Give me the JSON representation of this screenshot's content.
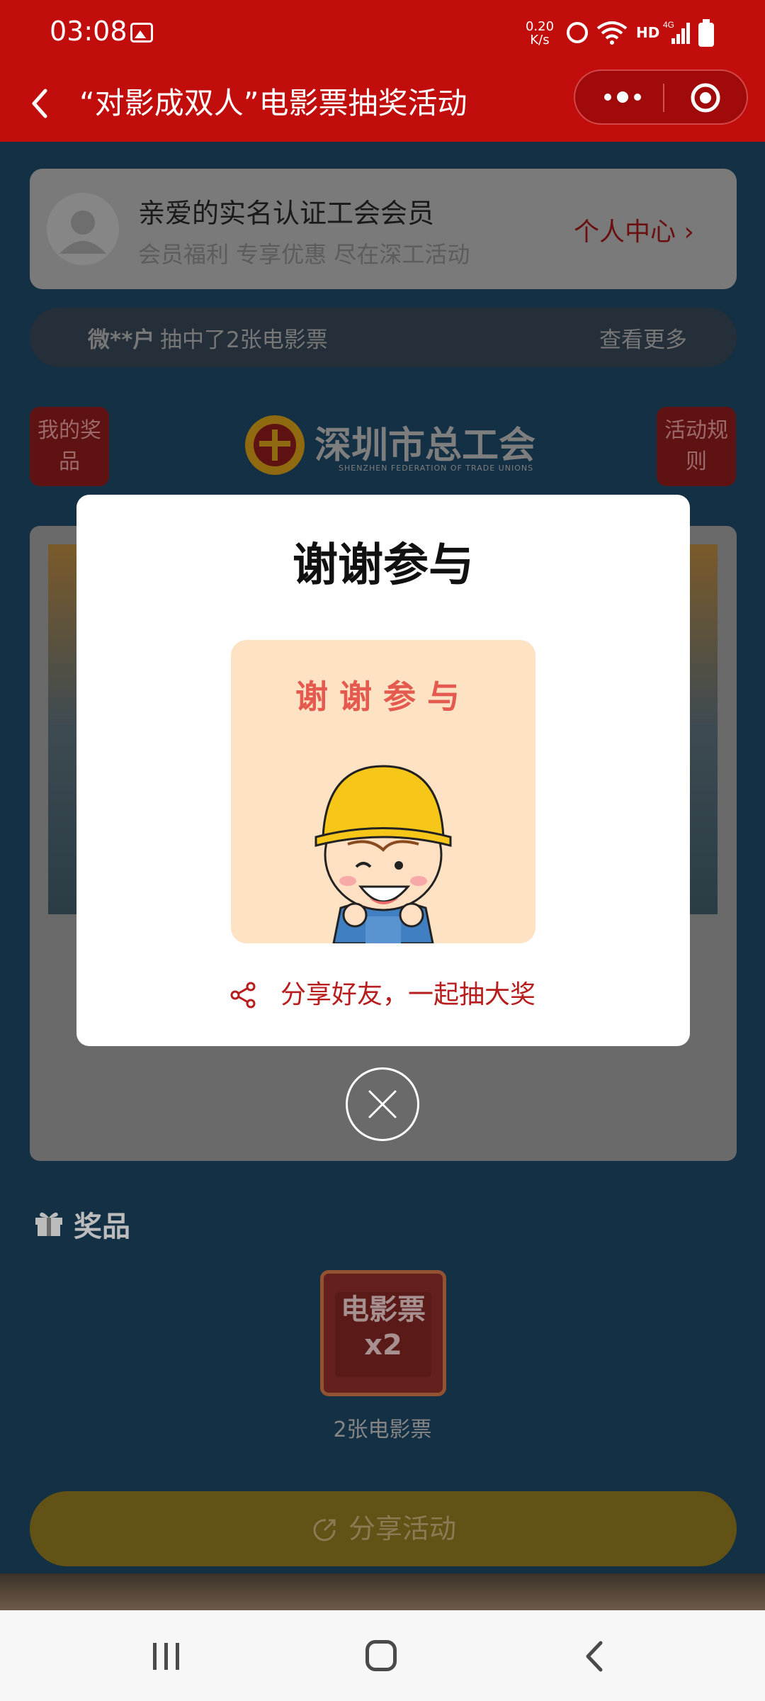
{
  "status_bar": {
    "time": "03:08",
    "net_speed": "0.20",
    "net_unit": "K/s",
    "hd": "HD",
    "network": "4G",
    "icons": [
      "gallery-icon",
      "alarm-icon",
      "wifi-icon",
      "signal-icon",
      "battery-icon"
    ]
  },
  "header": {
    "title": "“对影成双人”电影票抽奖活动",
    "icons": [
      "back-icon",
      "more-icon",
      "target-icon"
    ]
  },
  "member_card": {
    "greeting": "亲爱的实名认证工会会员",
    "subtitle": "会员福利 专享优惠 尽在深工活动",
    "profile_link": "个人中心"
  },
  "ticker": {
    "user": "微**户",
    "text": "抽中了2张电影票",
    "more": "查看更多"
  },
  "side_buttons": {
    "my_prizes": "我的奖品",
    "rules": "活动规则"
  },
  "union": {
    "name": "深圳市总工会",
    "name_en": "SHENZHEN FEDERATION OF TRADE UNIONS"
  },
  "prizes": {
    "heading": "奖品",
    "card_text": "电影票x2",
    "card_line1": "电影票",
    "card_line2": "x2",
    "name": "2张电影票"
  },
  "share_activity": {
    "label": "分享活动"
  },
  "modal": {
    "title": "谢谢参与",
    "image_caption": "谢谢参与",
    "share_text": "分享好友，一起抽大奖"
  },
  "colors": {
    "header_red": "#c20d0d",
    "accent_red": "#b81d1d",
    "caption_red": "#e45a4f",
    "helmet_yellow": "#f6c619",
    "image_bg": "#fde2c4"
  }
}
